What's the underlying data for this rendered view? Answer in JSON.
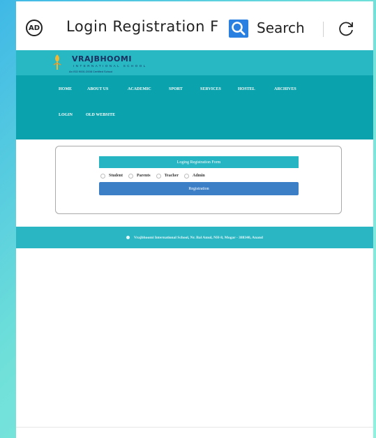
{
  "browser": {
    "tab_title": "Login Registration F",
    "search_label": "Search"
  },
  "site": {
    "logo_name": "VRAJBHOOMI",
    "logo_subtitle": "INTERNATIONAL SCHOOL",
    "logo_tagline": "An ISO 9001:2008 Certified School",
    "nav_row1": [
      "HOME",
      "ABOUT US",
      "ACADEMIC",
      "SPORT",
      "SERVICES",
      "HOSTEL",
      "ARCHIVES"
    ],
    "nav_row2": [
      "LOGIN",
      "OLD WEBSITE"
    ]
  },
  "form": {
    "title": "Loging Registration Form",
    "roles": [
      "Student",
      "Parents",
      "Teacher",
      "Admin"
    ],
    "button_label": "Registration"
  },
  "footer": {
    "address": "Vrajbhoomi International School, Nr. Bal Amul, NH-8, Mogar - 388340, Anand"
  },
  "colors": {
    "header_teal": "#0aa3ad",
    "accent_teal": "#26b5c2",
    "button_blue": "#3d7fc7",
    "search_blue": "#2a80e0"
  }
}
